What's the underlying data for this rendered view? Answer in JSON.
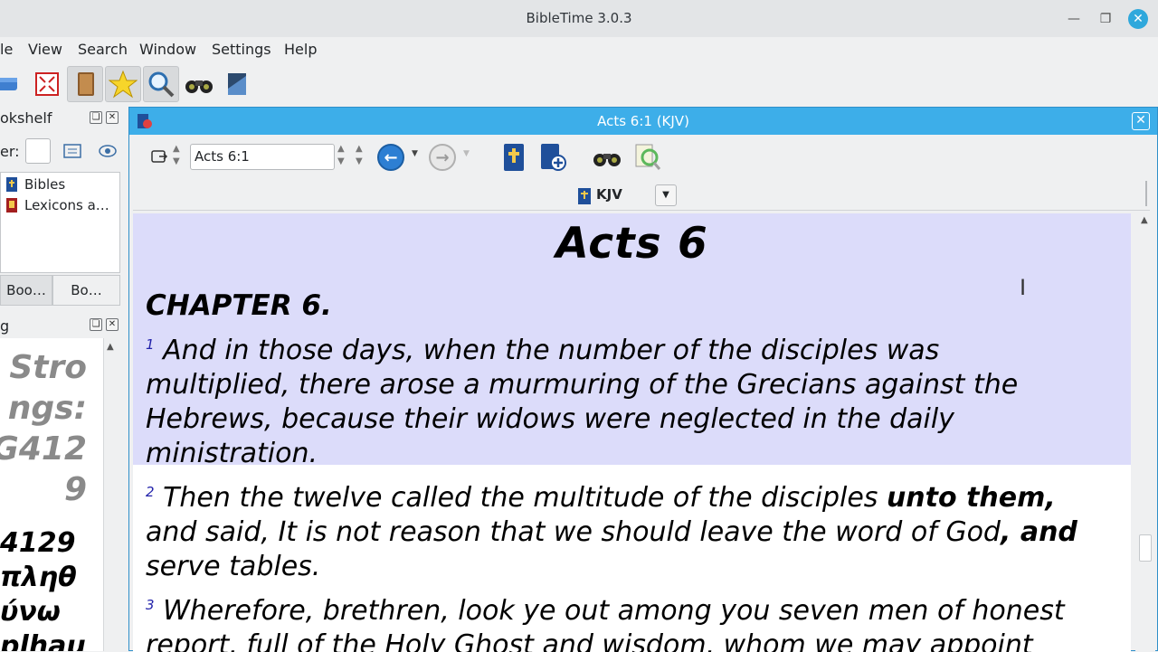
{
  "window": {
    "title": "BibleTime 3.0.3"
  },
  "menu": [
    {
      "label": "le"
    },
    {
      "label": "View"
    },
    {
      "label": "Search"
    },
    {
      "label": "Window"
    },
    {
      "label": "Settings"
    },
    {
      "label": "Help"
    }
  ],
  "bookshelf": {
    "title": "okshelf",
    "filter_label": "er:",
    "items": [
      {
        "label": "Bibles"
      },
      {
        "label": "Lexicons a…"
      }
    ],
    "tabs": [
      {
        "label": "Boo…"
      },
      {
        "label": "Bo…"
      }
    ]
  },
  "mag": {
    "title": "g",
    "strongs_lines": [
      "Stro",
      "ngs:",
      "G412",
      "9"
    ],
    "greek_lines": [
      "4129",
      "πληθ",
      "ύνω",
      "plhau"
    ]
  },
  "subwindow": {
    "title": "Acts 6:1 (KJV)",
    "key": "Acts 6:1",
    "module": "KJV"
  },
  "text": {
    "book_title": "Acts 6",
    "chapter": "CHAPTER 6.",
    "verses": [
      {
        "num": "1",
        "lines": [
          "And in those days, when the number of the disciples was",
          "multiplied, there arose a murmuring of the Grecians against the",
          "Hebrews, because their widows were neglected in the daily",
          "ministration."
        ]
      },
      {
        "num": "2",
        "line1_plain": "Then the twelve called the multitude of the disciples ",
        "line1_bold": "unto them,",
        "line2_plain": "and said, It is not reason that we should leave the word of God",
        "line2_bold": ", and",
        "line3": "serve tables."
      },
      {
        "num": "3",
        "lines": [
          "Wherefore, brethren, look ye out among you seven men of honest",
          "report, full of the Holy Ghost and wisdom, whom we may appoint"
        ]
      }
    ]
  },
  "colors": {
    "accent": "#3daee9",
    "highlight": "#dcdcfa"
  }
}
